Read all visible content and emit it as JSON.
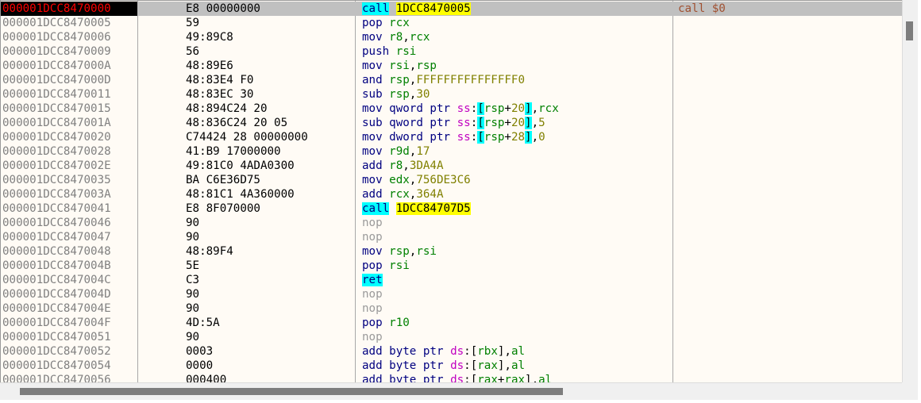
{
  "rows": [
    {
      "addr": "000001DCC8470000",
      "bytes": "E8 00000000",
      "selected": true,
      "dis": [
        {
          "t": "call",
          "c": "m hl"
        },
        {
          "t": " "
        },
        {
          "t": "1DCC8470005",
          "c": "lbl"
        }
      ],
      "comment": "call $0"
    },
    {
      "addr": "000001DCC8470005",
      "bytes": "59",
      "dis": [
        {
          "t": "pop",
          "c": "m"
        },
        {
          "t": " "
        },
        {
          "t": "rcx",
          "c": "r"
        }
      ]
    },
    {
      "addr": "000001DCC8470006",
      "bytes": "49:89C8",
      "dis": [
        {
          "t": "mov",
          "c": "m"
        },
        {
          "t": " "
        },
        {
          "t": "r8",
          "c": "r"
        },
        {
          "t": ","
        },
        {
          "t": "rcx",
          "c": "r"
        }
      ]
    },
    {
      "addr": "000001DCC8470009",
      "bytes": "56",
      "dis": [
        {
          "t": "push",
          "c": "m"
        },
        {
          "t": " "
        },
        {
          "t": "rsi",
          "c": "r"
        }
      ]
    },
    {
      "addr": "000001DCC847000A",
      "bytes": "48:89E6",
      "dis": [
        {
          "t": "mov",
          "c": "m"
        },
        {
          "t": " "
        },
        {
          "t": "rsi",
          "c": "r"
        },
        {
          "t": ","
        },
        {
          "t": "rsp",
          "c": "r"
        }
      ]
    },
    {
      "addr": "000001DCC847000D",
      "bytes": "48:83E4 F0",
      "dis": [
        {
          "t": "and",
          "c": "m"
        },
        {
          "t": " "
        },
        {
          "t": "rsp",
          "c": "r"
        },
        {
          "t": ","
        },
        {
          "t": "FFFFFFFFFFFFFFF0",
          "c": "n"
        }
      ]
    },
    {
      "addr": "000001DCC8470011",
      "bytes": "48:83EC 30",
      "dis": [
        {
          "t": "sub",
          "c": "m"
        },
        {
          "t": " "
        },
        {
          "t": "rsp",
          "c": "r"
        },
        {
          "t": ","
        },
        {
          "t": "30",
          "c": "n"
        }
      ]
    },
    {
      "addr": "000001DCC8470015",
      "bytes": "48:894C24 20",
      "dis": [
        {
          "t": "mov",
          "c": "m"
        },
        {
          "t": " "
        },
        {
          "t": "qword ptr",
          "c": "sz"
        },
        {
          "t": " "
        },
        {
          "t": "ss",
          "c": "seg"
        },
        {
          "t": ":"
        },
        {
          "t": "[",
          "c": "br"
        },
        {
          "t": "rsp",
          "c": "r"
        },
        {
          "t": "+",
          "c": "sub"
        },
        {
          "t": "20",
          "c": "n"
        },
        {
          "t": "]",
          "c": "br"
        },
        {
          "t": ","
        },
        {
          "t": "rcx",
          "c": "r"
        }
      ]
    },
    {
      "addr": "000001DCC847001A",
      "bytes": "48:836C24 20 05",
      "dis": [
        {
          "t": "sub",
          "c": "m"
        },
        {
          "t": " "
        },
        {
          "t": "qword ptr",
          "c": "sz"
        },
        {
          "t": " "
        },
        {
          "t": "ss",
          "c": "seg"
        },
        {
          "t": ":"
        },
        {
          "t": "[",
          "c": "br"
        },
        {
          "t": "rsp",
          "c": "r"
        },
        {
          "t": "+",
          "c": "sub"
        },
        {
          "t": "20",
          "c": "n"
        },
        {
          "t": "]",
          "c": "br"
        },
        {
          "t": ","
        },
        {
          "t": "5",
          "c": "n"
        }
      ]
    },
    {
      "addr": "000001DCC8470020",
      "bytes": "C74424 28 00000000",
      "dis": [
        {
          "t": "mov",
          "c": "m"
        },
        {
          "t": " "
        },
        {
          "t": "dword ptr",
          "c": "sz"
        },
        {
          "t": " "
        },
        {
          "t": "ss",
          "c": "seg"
        },
        {
          "t": ":"
        },
        {
          "t": "[",
          "c": "br"
        },
        {
          "t": "rsp",
          "c": "r"
        },
        {
          "t": "+",
          "c": "sub"
        },
        {
          "t": "28",
          "c": "n"
        },
        {
          "t": "]",
          "c": "br"
        },
        {
          "t": ","
        },
        {
          "t": "0",
          "c": "n"
        }
      ]
    },
    {
      "addr": "000001DCC8470028",
      "bytes": "41:B9 17000000",
      "dis": [
        {
          "t": "mov",
          "c": "m"
        },
        {
          "t": " "
        },
        {
          "t": "r9d",
          "c": "r"
        },
        {
          "t": ","
        },
        {
          "t": "17",
          "c": "n"
        }
      ]
    },
    {
      "addr": "000001DCC847002E",
      "bytes": "49:81C0 4ADA0300",
      "dis": [
        {
          "t": "add",
          "c": "m"
        },
        {
          "t": " "
        },
        {
          "t": "r8",
          "c": "r"
        },
        {
          "t": ","
        },
        {
          "t": "3DA4A",
          "c": "n"
        }
      ]
    },
    {
      "addr": "000001DCC8470035",
      "bytes": "BA C6E36D75",
      "dis": [
        {
          "t": "mov",
          "c": "m"
        },
        {
          "t": " "
        },
        {
          "t": "edx",
          "c": "r"
        },
        {
          "t": ","
        },
        {
          "t": "756DE3C6",
          "c": "n"
        }
      ]
    },
    {
      "addr": "000001DCC847003A",
      "bytes": "48:81C1 4A360000",
      "dis": [
        {
          "t": "add",
          "c": "m"
        },
        {
          "t": " "
        },
        {
          "t": "rcx",
          "c": "r"
        },
        {
          "t": ","
        },
        {
          "t": "364A",
          "c": "n"
        }
      ]
    },
    {
      "addr": "000001DCC8470041",
      "bytes": "E8 8F070000",
      "dis": [
        {
          "t": "call",
          "c": "m hl"
        },
        {
          "t": " "
        },
        {
          "t": "1DCC84707D5",
          "c": "lbl"
        }
      ]
    },
    {
      "addr": "000001DCC8470046",
      "bytes": "90",
      "dis": [
        {
          "t": "nop",
          "c": "m nop"
        }
      ]
    },
    {
      "addr": "000001DCC8470047",
      "bytes": "90",
      "dis": [
        {
          "t": "nop",
          "c": "m nop"
        }
      ]
    },
    {
      "addr": "000001DCC8470048",
      "bytes": "48:89F4",
      "dis": [
        {
          "t": "mov",
          "c": "m"
        },
        {
          "t": " "
        },
        {
          "t": "rsp",
          "c": "r"
        },
        {
          "t": ","
        },
        {
          "t": "rsi",
          "c": "r"
        }
      ]
    },
    {
      "addr": "000001DCC847004B",
      "bytes": "5E",
      "dis": [
        {
          "t": "pop",
          "c": "m"
        },
        {
          "t": " "
        },
        {
          "t": "rsi",
          "c": "r"
        }
      ]
    },
    {
      "addr": "000001DCC847004C",
      "bytes": "C3",
      "dis": [
        {
          "t": "ret",
          "c": "m hl"
        }
      ]
    },
    {
      "addr": "000001DCC847004D",
      "bytes": "90",
      "dis": [
        {
          "t": "nop",
          "c": "m nop"
        }
      ]
    },
    {
      "addr": "000001DCC847004E",
      "bytes": "90",
      "dis": [
        {
          "t": "nop",
          "c": "m nop"
        }
      ]
    },
    {
      "addr": "000001DCC847004F",
      "bytes": "4D:5A",
      "dis": [
        {
          "t": "pop",
          "c": "m"
        },
        {
          "t": " "
        },
        {
          "t": "r10",
          "c": "r"
        }
      ]
    },
    {
      "addr": "000001DCC8470051",
      "bytes": "90",
      "dis": [
        {
          "t": "nop",
          "c": "m nop"
        }
      ]
    },
    {
      "addr": "000001DCC8470052",
      "bytes": "0003",
      "dis": [
        {
          "t": "add",
          "c": "m"
        },
        {
          "t": " "
        },
        {
          "t": "byte ptr",
          "c": "sz"
        },
        {
          "t": " "
        },
        {
          "t": "ds",
          "c": "seg"
        },
        {
          "t": ":"
        },
        {
          "t": "["
        },
        {
          "t": "rbx",
          "c": "r"
        },
        {
          "t": "]"
        },
        {
          "t": ","
        },
        {
          "t": "al",
          "c": "r"
        }
      ]
    },
    {
      "addr": "000001DCC8470054",
      "bytes": "0000",
      "dis": [
        {
          "t": "add",
          "c": "m"
        },
        {
          "t": " "
        },
        {
          "t": "byte ptr",
          "c": "sz"
        },
        {
          "t": " "
        },
        {
          "t": "ds",
          "c": "seg"
        },
        {
          "t": ":"
        },
        {
          "t": "["
        },
        {
          "t": "rax",
          "c": "r"
        },
        {
          "t": "]"
        },
        {
          "t": ","
        },
        {
          "t": "al",
          "c": "r"
        }
      ]
    },
    {
      "addr": "000001DCC8470056",
      "bytes": "000400",
      "dis": [
        {
          "t": "add",
          "c": "m"
        },
        {
          "t": " "
        },
        {
          "t": "byte ptr",
          "c": "sz"
        },
        {
          "t": " "
        },
        {
          "t": "ds",
          "c": "seg"
        },
        {
          "t": ":"
        },
        {
          "t": "["
        },
        {
          "t": "rax",
          "c": "r"
        },
        {
          "t": "+",
          "c": "sub"
        },
        {
          "t": "rax",
          "c": "r"
        },
        {
          "t": "]"
        },
        {
          "t": ","
        },
        {
          "t": "al",
          "c": "r"
        }
      ]
    }
  ],
  "scroll": {
    "vertical_position": 0.06,
    "horizontal_visible_fraction": 0.63
  }
}
